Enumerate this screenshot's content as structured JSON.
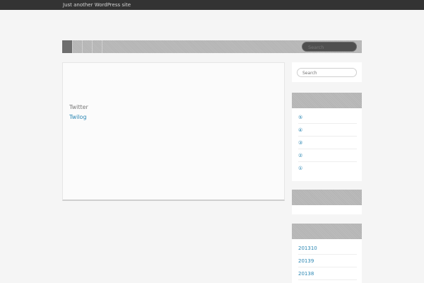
{
  "site": {
    "tagline": "Just another WordPress site"
  },
  "nav": {
    "search_placeholder": "Search"
  },
  "content": {
    "heading": "Twitter",
    "link": "Twilog"
  },
  "sidebar": {
    "search_placeholder": "Search",
    "recent_posts": [
      "⑤",
      "④",
      "③",
      "②",
      "①"
    ],
    "archives": [
      "201310",
      "20139",
      "20138"
    ]
  },
  "colors": {
    "link": "#2a86b3",
    "topbar": "#333333",
    "background": "#f5f5f5"
  }
}
